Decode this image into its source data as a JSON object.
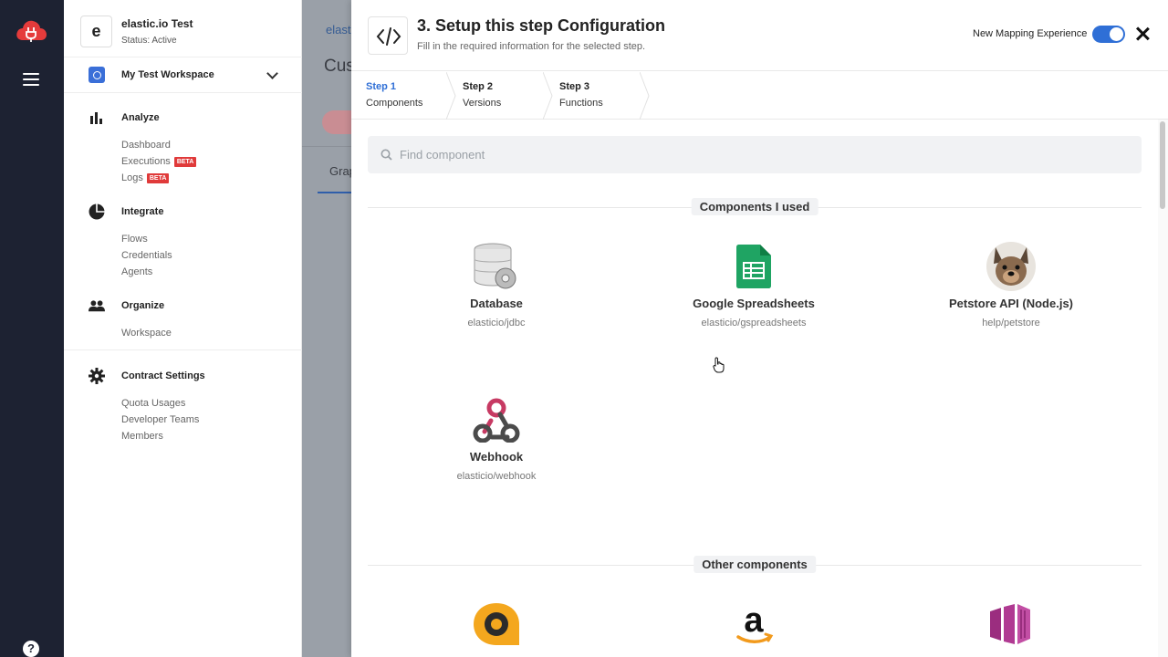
{
  "rail": {
    "logo_icon": "cloud-plug-icon",
    "menu_icon": "hamburger-icon",
    "help_label": "?"
  },
  "workspace": {
    "avatar_letter": "e",
    "name": "elastic.io Test",
    "status": "Status: Active",
    "selected": "My Test Workspace"
  },
  "sidebar": {
    "sections": [
      {
        "title": "Analyze",
        "icon": "bar-chart-icon",
        "items": [
          {
            "label": "Dashboard"
          },
          {
            "label": "Executions",
            "badge": "BETA"
          },
          {
            "label": "Logs",
            "badge": "BETA"
          }
        ]
      },
      {
        "title": "Integrate",
        "icon": "pie-chart-icon",
        "items": [
          {
            "label": "Flows"
          },
          {
            "label": "Credentials"
          },
          {
            "label": "Agents"
          }
        ]
      },
      {
        "title": "Organize",
        "icon": "people-icon",
        "items": [
          {
            "label": "Workspace"
          }
        ]
      },
      {
        "title": "Contract Settings",
        "icon": "gear-icon",
        "items": [
          {
            "label": "Quota Usages"
          },
          {
            "label": "Developer Teams"
          },
          {
            "label": "Members"
          }
        ]
      }
    ]
  },
  "background": {
    "crumb": "elasti",
    "title": "Cust",
    "tab": "Grap"
  },
  "modal": {
    "title": "3. Setup this step Configuration",
    "subtitle": "Fill in the required information for the selected step.",
    "toggle_label": "New Mapping Experience",
    "toggle_on": true,
    "steps": [
      {
        "num": "Step 1",
        "label": "Components",
        "active": true
      },
      {
        "num": "Step 2",
        "label": "Versions",
        "active": false
      },
      {
        "num": "Step 3",
        "label": "Functions",
        "active": false
      }
    ],
    "search_placeholder": "Find component",
    "used_header": "Components I used",
    "other_header": "Other components",
    "used": [
      {
        "name": "Database",
        "slug": "elasticio/jdbc",
        "icon": "database-icon"
      },
      {
        "name": "Google Spreadsheets",
        "slug": "elasticio/gspreadsheets",
        "icon": "spreadsheet-icon"
      },
      {
        "name": "Petstore API (Node.js)",
        "slug": "help/petstore",
        "icon": "dog-avatar-icon"
      },
      {
        "name": "Webhook",
        "slug": "elasticio/webhook",
        "icon": "webhook-icon"
      }
    ],
    "other_icons": [
      "quip-icon",
      "amazon-icon",
      "aws-kinesis-icon"
    ]
  },
  "colors": {
    "rail": "#1d2232",
    "accent": "#2f6fd6",
    "beta": "#e03a3a"
  }
}
